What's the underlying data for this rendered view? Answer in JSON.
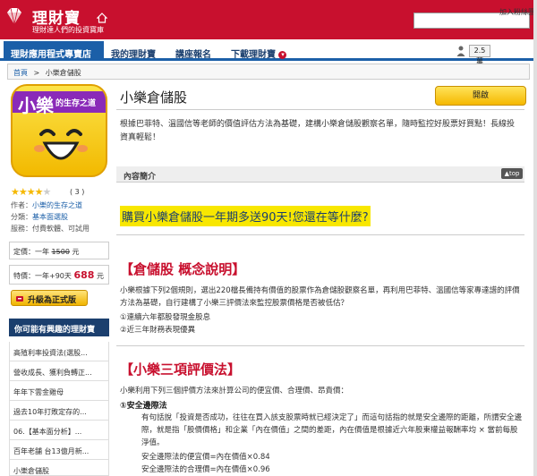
{
  "header": {
    "logo_title": "理財寶",
    "slogan": "理財達人們的投資寶庫"
  },
  "nav": {
    "items": [
      {
        "label": "理財應用程式專賣店"
      },
      {
        "label": "我的理財寶"
      },
      {
        "label": "講座報名"
      },
      {
        "label": "下載理財寶"
      }
    ],
    "stat_value": "2.5 萬",
    "add_fan": "加入粉絲團"
  },
  "breadcrumb": {
    "home": "首頁",
    "sep": ">",
    "current": "小樂倉儲股"
  },
  "app": {
    "icon_big": "小樂",
    "icon_sub": "的生存之道",
    "rating_count": "( 3 )",
    "author_label": "作者：",
    "author": "小樂的生存之道",
    "category_label": "分類：",
    "category": "基本面選股",
    "service_label": "服務：",
    "service": "付費軟體、可試用"
  },
  "price": {
    "regular_label": "定價：一年",
    "regular_value": "1500",
    "regular_unit": "元",
    "special_label": "特價：一年+90天",
    "special_value": "688",
    "special_unit": "元",
    "upgrade": "升級為正式版"
  },
  "recommend": {
    "title": "你可能有興趣的理財寶",
    "items": [
      "高殖利率投資法(選股...",
      "營收成長、獲利負轉正...",
      "年年下雲金雞母",
      "過去10年打敗定存的...",
      "06.【基本面分析】...",
      "百年老舗 台13億月新...",
      "小樂倉儲股"
    ]
  },
  "main": {
    "title": "小樂倉儲股",
    "open_button": "開啟",
    "description": "根據巴菲特、溫國信等老師的價值評估方法為基礎，建構小樂倉儲股觀察名單，隨時監控好股票好買點！長線投資真輕鬆！",
    "section_label": "內容簡介",
    "top_label": "▲top",
    "promo": "購買小樂倉儲股一年期多送90天!您還在等什麼?",
    "heading1": "【倉儲股 概念說明】",
    "para1": "小樂根據下列2個規則，選出220檔長備持有價值的股票作為倉儲股觀察名單，再利用巴菲特、溫國信等家專達譜的評價方法為基礎，自行建構了小樂三評價法來監控股票價格是否被低估？",
    "rule1": "①連續六年都股發現金股息",
    "rule2": "②近三年財務表現優異",
    "heading2": "【小樂三項評價法】",
    "para2": "小樂利用下列三個評價方法來計算公司的便宜價、合理價、昂貴價：",
    "method1": "①安全邊際法",
    "method1_desc": "有句話說「投資是否成功，往往在買入該支股票時就已經決定了」而這句話指的就是安全邊際的距離，所謂安全邊際，就是指「股價價格」和企業「內在價值」之間的差距，內在價值是根據近六年股東權益報酬率均 × 當前每股淨值。",
    "formula1": "安全邊際法的便宜價=內在價值×0.84",
    "formula2": "安全邊際法的合理價=內在價值×0.96"
  }
}
